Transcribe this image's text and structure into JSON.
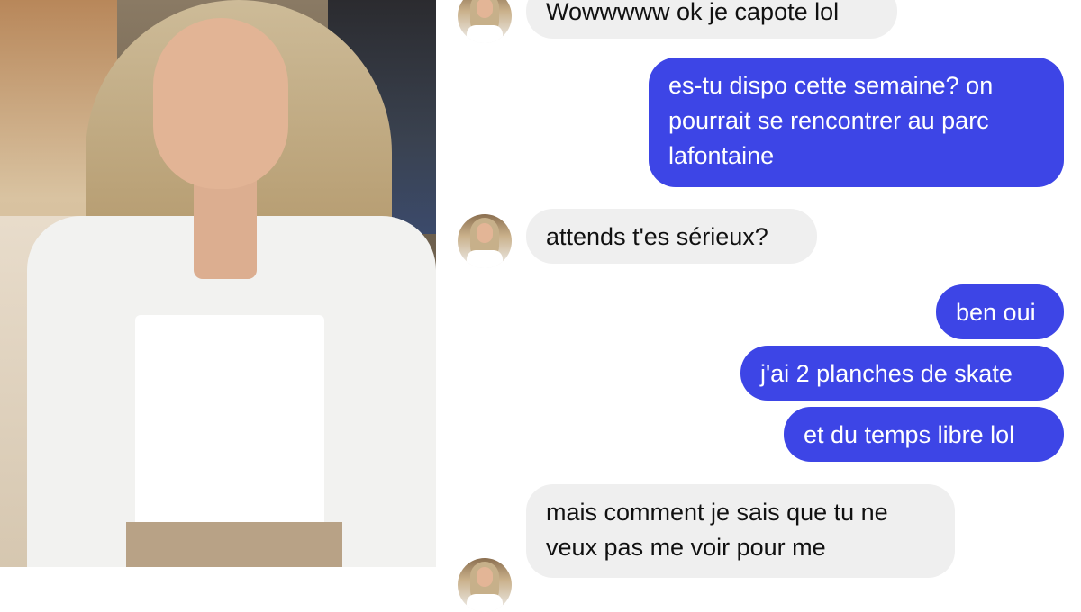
{
  "colors": {
    "outgoing_bubble": "#3d45e6",
    "incoming_bubble": "#efefef",
    "outgoing_text": "#ffffff",
    "incoming_text": "#111111"
  },
  "messages": [
    {
      "direction": "incoming",
      "text": "Wowwwww ok je capote lol",
      "avatar": true
    },
    {
      "direction": "outgoing",
      "text": "es-tu dispo cette semaine? on\npourrait se rencontrer au parc\nlafontaine"
    },
    {
      "direction": "incoming",
      "text": "attends t'es sérieux?",
      "avatar": true
    },
    {
      "direction": "outgoing",
      "text": "ben oui"
    },
    {
      "direction": "outgoing",
      "text": "j'ai 2 planches de skate"
    },
    {
      "direction": "outgoing",
      "text": "et du temps libre lol"
    },
    {
      "direction": "incoming",
      "text": "mais comment je sais que tu ne\nveux pas me voir pour me",
      "avatar": true
    }
  ]
}
